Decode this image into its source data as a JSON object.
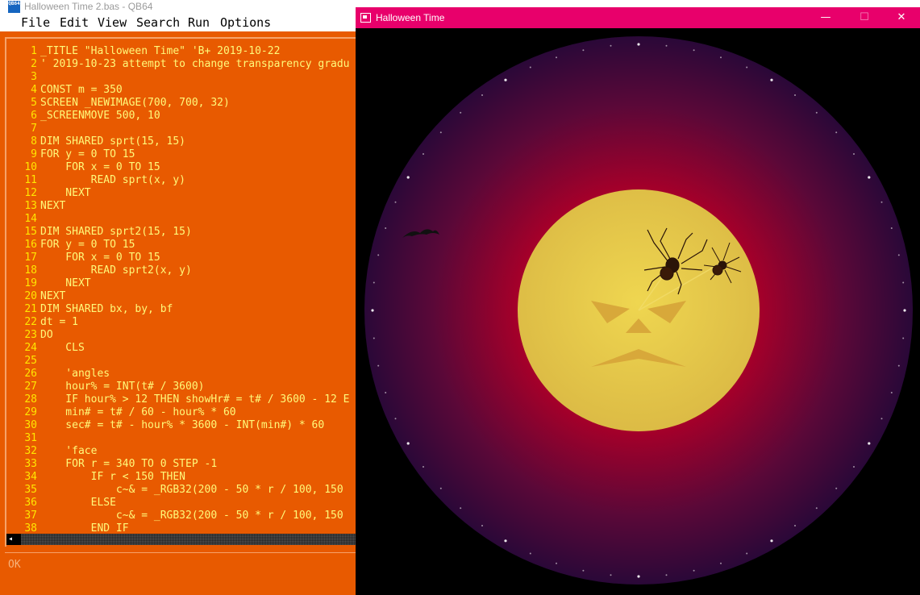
{
  "ide": {
    "title": "Halloween Time 2.bas - QB64",
    "app_icon_label": "QB64",
    "menu": [
      "File",
      "Edit",
      "View",
      "Search",
      "Run",
      "Options"
    ],
    "status": "OK",
    "code_lines": [
      {
        "n": "1",
        "t": "_TITLE \"Halloween Time\" 'B+ 2019-10-22"
      },
      {
        "n": "2",
        "t": "' 2019-10-23 attempt to change transparency gradu"
      },
      {
        "n": "3",
        "t": ""
      },
      {
        "n": "4",
        "t": "CONST m = 350"
      },
      {
        "n": "5",
        "t": "SCREEN _NEWIMAGE(700, 700, 32)"
      },
      {
        "n": "6",
        "t": "_SCREENMOVE 500, 10"
      },
      {
        "n": "7",
        "t": ""
      },
      {
        "n": "8",
        "t": "DIM SHARED sprt(15, 15)"
      },
      {
        "n": "9",
        "t": "FOR y = 0 TO 15"
      },
      {
        "n": "10",
        "t": "    FOR x = 0 TO 15"
      },
      {
        "n": "11",
        "t": "        READ sprt(x, y)"
      },
      {
        "n": "12",
        "t": "    NEXT"
      },
      {
        "n": "13",
        "t": "NEXT"
      },
      {
        "n": "14",
        "t": ""
      },
      {
        "n": "15",
        "t": "DIM SHARED sprt2(15, 15)"
      },
      {
        "n": "16",
        "t": "FOR y = 0 TO 15"
      },
      {
        "n": "17",
        "t": "    FOR x = 0 TO 15"
      },
      {
        "n": "18",
        "t": "        READ sprt2(x, y)"
      },
      {
        "n": "19",
        "t": "    NEXT"
      },
      {
        "n": "20",
        "t": "NEXT"
      },
      {
        "n": "21",
        "t": "DIM SHARED bx, by, bf"
      },
      {
        "n": "22",
        "t": "dt = 1"
      },
      {
        "n": "23",
        "t": "DO"
      },
      {
        "n": "24",
        "t": "    CLS"
      },
      {
        "n": "25",
        "t": ""
      },
      {
        "n": "26",
        "t": "    'angles"
      },
      {
        "n": "27",
        "t": "    hour% = INT(t# / 3600)"
      },
      {
        "n": "28",
        "t": "    IF hour% > 12 THEN showHr# = t# / 3600 - 12 E"
      },
      {
        "n": "29",
        "t": "    min# = t# / 60 - hour% * 60"
      },
      {
        "n": "30",
        "t": "    sec# = t# - hour% * 3600 - INT(min#) * 60"
      },
      {
        "n": "31",
        "t": ""
      },
      {
        "n": "32",
        "t": "    'face"
      },
      {
        "n": "33",
        "t": "    FOR r = 340 TO 0 STEP -1"
      },
      {
        "n": "34",
        "t": "        IF r < 150 THEN"
      },
      {
        "n": "35",
        "t": "            c~& = _RGB32(200 - 50 * r / 100, 150"
      },
      {
        "n": "36",
        "t": "        ELSE"
      },
      {
        "n": "37",
        "t": "            c~& = _RGB32(200 - 50 * r / 100, 150"
      },
      {
        "n": "38",
        "t": "        END IF"
      }
    ],
    "colors": {
      "background": "#e85a00",
      "line_numbers": "#ffe600",
      "code_text": "#fffa7a"
    }
  },
  "halloween": {
    "title": "Halloween Time",
    "minimize_glyph": "—",
    "maximize_glyph": "☐",
    "close_glyph": "✕",
    "colors": {
      "titlebar": "#e8006b",
      "moon": "#e8c84a",
      "dial_outer": "#3a0a3a",
      "dial_inner": "#a3002a"
    }
  }
}
